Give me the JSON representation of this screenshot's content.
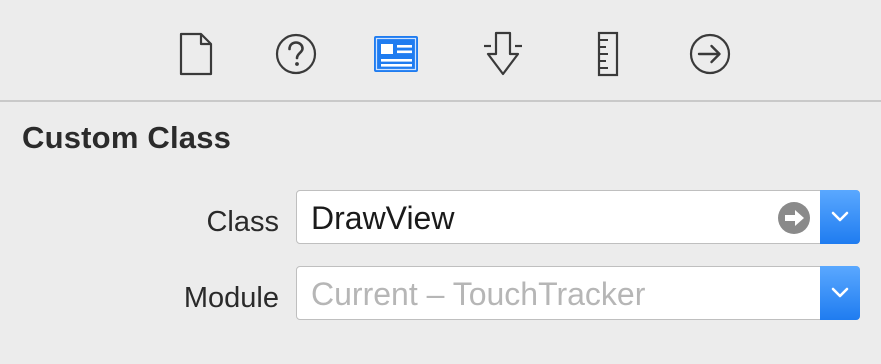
{
  "tabs": [
    {
      "name": "file-inspector",
      "icon": "document-icon",
      "selected": false
    },
    {
      "name": "quick-help",
      "icon": "question-circle-icon",
      "selected": false
    },
    {
      "name": "identity-inspector",
      "icon": "identity-card-icon",
      "selected": true
    },
    {
      "name": "attributes-inspector",
      "icon": "attribute-arrow-icon",
      "selected": false
    },
    {
      "name": "size-inspector",
      "icon": "ruler-icon",
      "selected": false
    },
    {
      "name": "connections-inspector",
      "icon": "arrow-circle-icon",
      "selected": false
    }
  ],
  "section": {
    "title": "Custom Class"
  },
  "class_field": {
    "label": "Class",
    "value": "DrawView",
    "go_icon": "arrow-right-circle-icon",
    "dropdown_icon": "chevron-down-icon"
  },
  "module_field": {
    "label": "Module",
    "placeholder": "Current – TouchTracker",
    "dropdown_icon": "chevron-down-icon"
  },
  "colors": {
    "accent": "#1f7cf0",
    "background": "#ececec",
    "icon_gray": "#3a3a3a"
  }
}
